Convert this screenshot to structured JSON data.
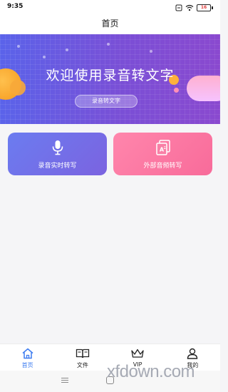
{
  "status_bar": {
    "time": "9:35",
    "battery": "16"
  },
  "header": {
    "title": "首页"
  },
  "banner": {
    "headline": "欢迎使用录音转文字",
    "pill": "录音转文字"
  },
  "features": [
    {
      "label": "录音实时转写",
      "icon": "microphone-icon",
      "color": "#6b7cf0"
    },
    {
      "label": "外部音频转写",
      "icon": "audio-file-icon",
      "color": "#f86b9a"
    }
  ],
  "tabs": [
    {
      "label": "首页",
      "icon": "home-icon",
      "active": true
    },
    {
      "label": "文件",
      "icon": "book-icon",
      "active": false
    },
    {
      "label": "VIP",
      "icon": "crown-icon",
      "active": false
    },
    {
      "label": "我的",
      "icon": "user-icon",
      "active": false
    }
  ],
  "watermark": "xfdown.com",
  "colors": {
    "accent": "#3d7cf0",
    "banner": "#6a5ae0",
    "pink": "#f86b9a"
  }
}
